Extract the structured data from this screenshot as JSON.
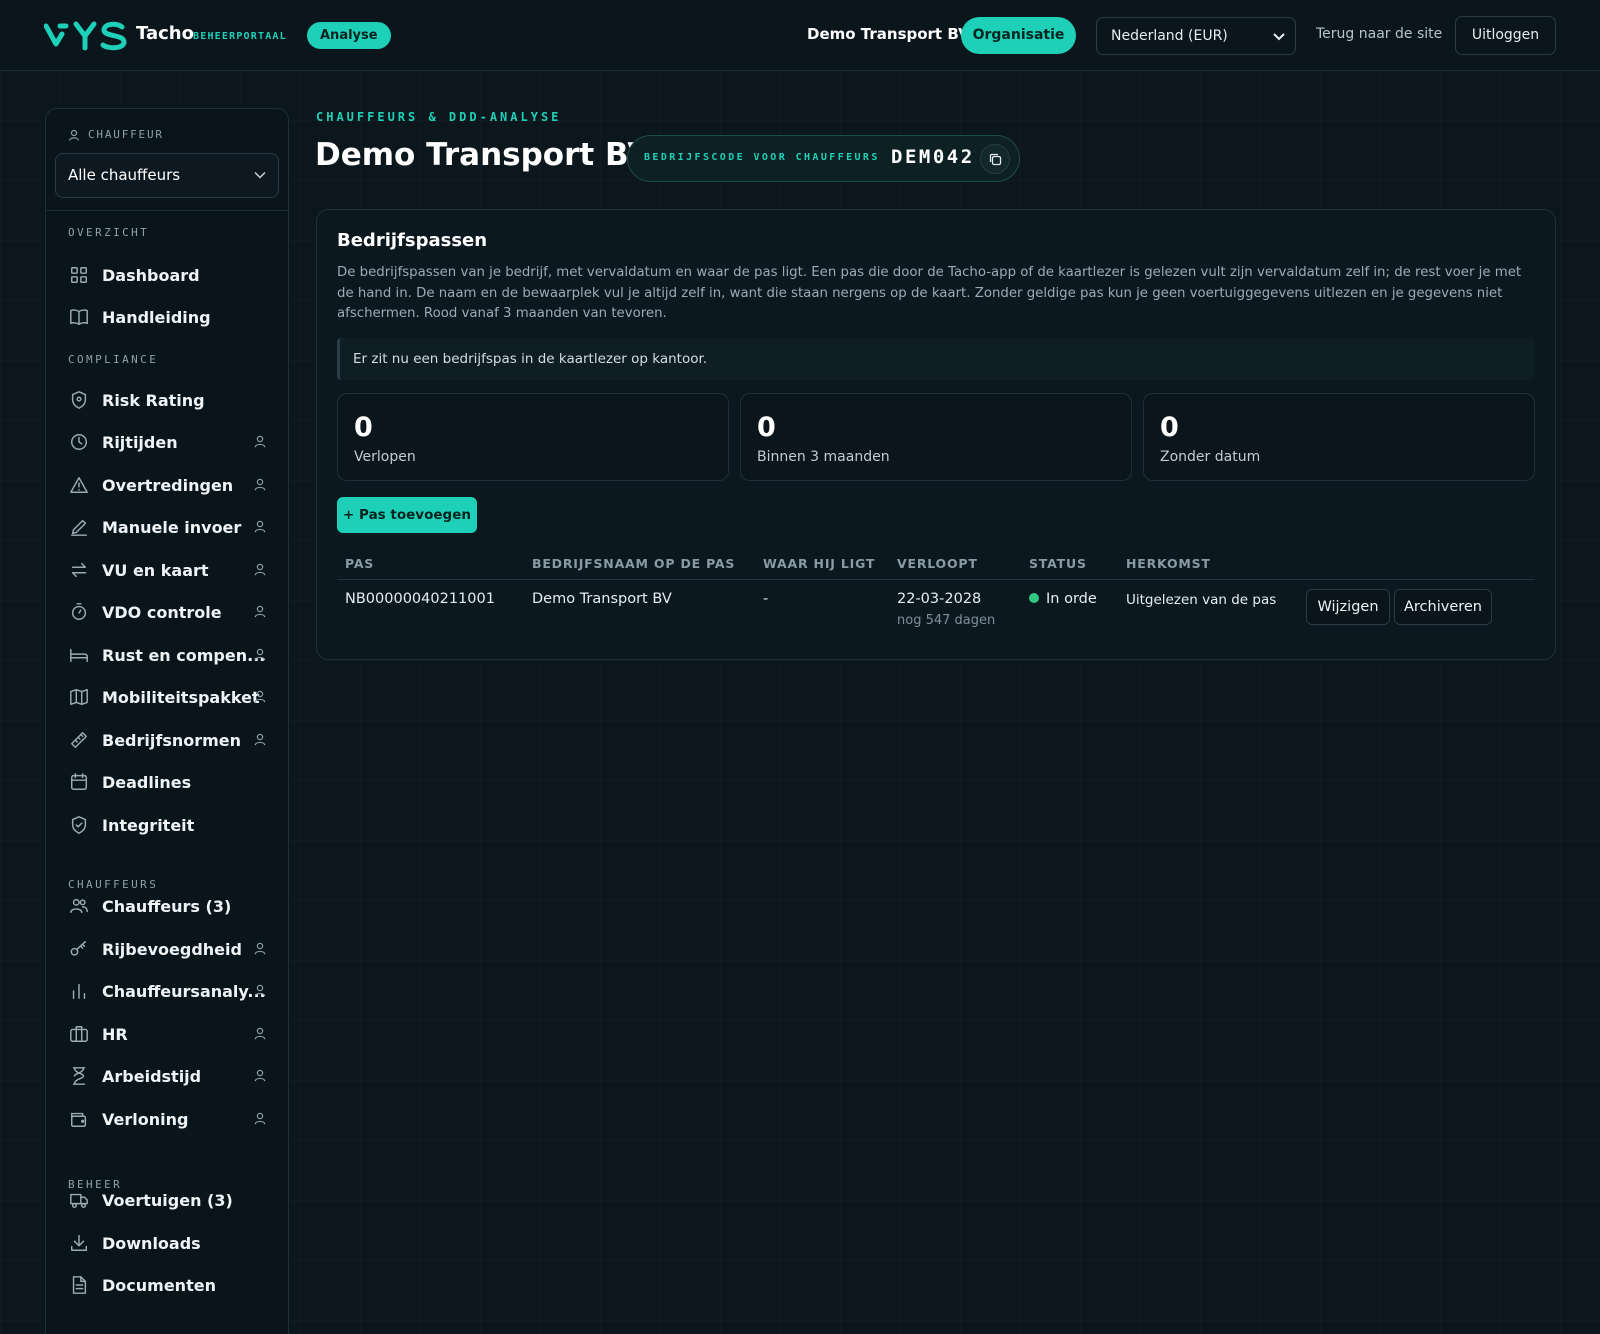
{
  "topbar": {
    "brand": "Tacho",
    "brand_sub": "BEHEERPORTAAL",
    "mode_pill": "Analyse",
    "org_name": "Demo Transport BV",
    "org_button": "Organisatie",
    "country_select": "Nederland (EUR)",
    "back_link": "Terug naar de site",
    "logout": "Uitloggen",
    "accent": "#1ed0b8"
  },
  "sidebar": {
    "driver_label": "CHAUFFEUR",
    "driver_select": "Alle chauffeurs",
    "sections": {
      "overview": "OVERZICHT",
      "compliance": "COMPLIANCE",
      "drivers": "CHAUFFEURS",
      "manage": "BEHEER"
    },
    "items": [
      {
        "label": "Dashboard",
        "icon": "dashboard-icon",
        "per_driver": false
      },
      {
        "label": "Handleiding",
        "icon": "book-icon",
        "per_driver": false
      },
      {
        "label": "Risk Rating",
        "icon": "shield-icon",
        "per_driver": false
      },
      {
        "label": "Rijtijden",
        "icon": "clock-icon",
        "per_driver": true
      },
      {
        "label": "Overtredingen",
        "icon": "warning-icon",
        "per_driver": true
      },
      {
        "label": "Manuele invoer",
        "icon": "pencil-icon",
        "per_driver": true
      },
      {
        "label": "VU en kaart",
        "icon": "swap-icon",
        "per_driver": true
      },
      {
        "label": "VDO controle",
        "icon": "stopwatch-icon",
        "per_driver": true
      },
      {
        "label": "Rust en compen...",
        "icon": "bed-icon",
        "per_driver": true
      },
      {
        "label": "Mobiliteitspakket",
        "icon": "map-icon",
        "per_driver": true
      },
      {
        "label": "Bedrijfsnormen",
        "icon": "ruler-icon",
        "per_driver": true
      },
      {
        "label": "Deadlines",
        "icon": "calendar-icon",
        "per_driver": false
      },
      {
        "label": "Integriteit",
        "icon": "shield-check-icon",
        "per_driver": false
      },
      {
        "label": "Chauffeurs (3)",
        "icon": "users-icon",
        "per_driver": false
      },
      {
        "label": "Rijbevoegdheid",
        "icon": "key-icon",
        "per_driver": true
      },
      {
        "label": "Chauffeursanaly...",
        "icon": "bar-chart-icon",
        "per_driver": true
      },
      {
        "label": "HR",
        "icon": "briefcase-icon",
        "per_driver": true
      },
      {
        "label": "Arbeidstijd",
        "icon": "hourglass-icon",
        "per_driver": true
      },
      {
        "label": "Verloning",
        "icon": "wallet-icon",
        "per_driver": true
      },
      {
        "label": "Voertuigen (3)",
        "icon": "truck-icon",
        "per_driver": false
      },
      {
        "label": "Downloads",
        "icon": "download-icon",
        "per_driver": false
      },
      {
        "label": "Documenten",
        "icon": "document-icon",
        "per_driver": false
      }
    ]
  },
  "main": {
    "kicker": "CHAUFFEURS & DDD-ANALYSE",
    "title": "Demo Transport BV",
    "company_code_label": "BEDRIJFSCODE VOOR CHAUFFEURS",
    "company_code": "DEM042",
    "card": {
      "title": "Bedrijfspassen",
      "description": "De bedrijfspassen van je bedrijf, met vervaldatum en waar de pas ligt. Een pas die door de Tacho-app of de kaartlezer is gelezen vult zijn vervaldatum zelf in; de rest voer je met de hand in. De naam en de bewaarplek vul je altijd zelf in, want die staan nergens op de kaart. Zonder geldige pas kun je geen voertuiggegevens uitlezen en je gegevens niet afschermen. Rood vanaf 3 maanden van tevoren.",
      "notice": "Er zit nu een bedrijfspas in de kaartlezer op kantoor.",
      "stats": [
        {
          "value": "0",
          "label": "Verlopen"
        },
        {
          "value": "0",
          "label": "Binnen 3 maanden"
        },
        {
          "value": "0",
          "label": "Zonder datum"
        }
      ],
      "add_button": "+ Pas toevoegen",
      "columns": [
        "PAS",
        "BEDRIJFSNAAM OP DE PAS",
        "WAAR HIJ LIGT",
        "VERLOOPT",
        "STATUS",
        "HERKOMST"
      ],
      "rows": [
        {
          "pas": "NB00000040211001",
          "company": "Demo Transport BV",
          "location": "-",
          "expires": "22-03-2028",
          "expires_sub": "nog 547 dagen",
          "status": "In orde",
          "status_color": "#2fc983",
          "origin": "Uitgelezen van de pas",
          "edit": "Wijzigen",
          "archive": "Archiveren"
        }
      ]
    }
  }
}
